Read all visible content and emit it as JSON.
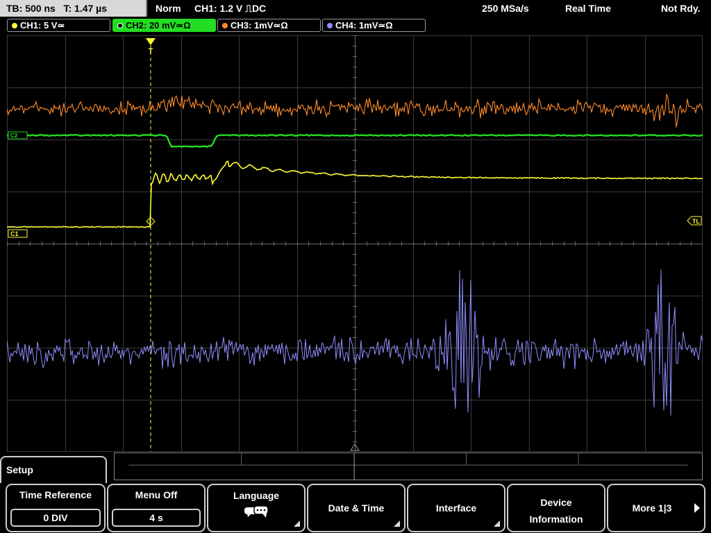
{
  "status": {
    "timebase": "TB: 500 ns",
    "trigger_time": "T: 1.47 µs",
    "mode": "Norm",
    "trigger": "CH1: 1.2 V ⎍DC",
    "sample_rate": "250 MSa/s",
    "acquisition": "Real Time",
    "state": "Not Rdy."
  },
  "channels": [
    {
      "label": "CH1: 5 V≃",
      "color": "#ffff33"
    },
    {
      "label": "CH2: 20 mV≃Ω",
      "color": "#22dd22"
    },
    {
      "label": "CH3: 1mV≃Ω",
      "color": "#ff8c2a"
    },
    {
      "label": "CH4: 1mV≃Ω",
      "color": "#8f8fff"
    }
  ],
  "markers": {
    "trigger_pos": "T",
    "ch1_ref": "C1",
    "ch2_ref": "C2",
    "trigger_level": "TL"
  },
  "menu": {
    "title": "Setup",
    "buttons": [
      {
        "label": "Time Reference",
        "value": "0 DIV"
      },
      {
        "label": "Menu Off",
        "value": "4 s"
      },
      {
        "label": "Language",
        "icon": "speech-bubbles-icon"
      },
      {
        "label": "Date & Time"
      },
      {
        "label": "Interface"
      },
      {
        "label": "Device Information"
      },
      {
        "label": "More 1|3",
        "icon": "arrow-right-icon"
      }
    ]
  }
}
